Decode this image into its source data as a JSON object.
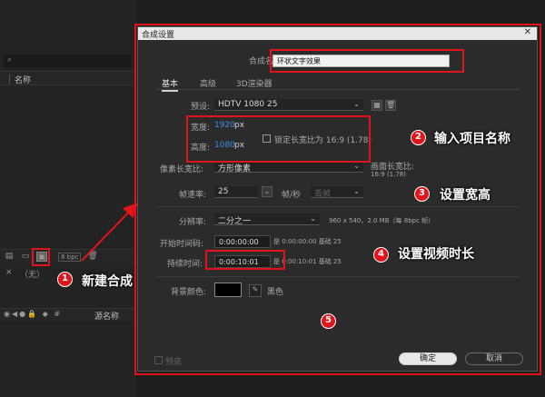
{
  "background": {
    "project_column_header": "名称",
    "bpc_label": "8 bpc",
    "comp_tab_label": "（无）",
    "layer_source_header": "源名称"
  },
  "dialog": {
    "title": "合成设置",
    "close_glyph": "✕",
    "comp_name_label": "合成名称:",
    "comp_name_value": "环状文字效果",
    "tabs": [
      "基本",
      "高级",
      "3D渲染器"
    ],
    "preset_label": "预设:",
    "preset_value": "HDTV 1080 25",
    "width_label": "宽度:",
    "width_value": "1920",
    "width_unit": "px",
    "height_label": "高度:",
    "height_value": "1080",
    "height_unit": "px",
    "lock_label": "锁定长宽比为 16:9 (1.78)",
    "pixel_aspect_label": "像素长宽比:",
    "pixel_aspect_value": "方形像素",
    "frame_aspect_label": "画面长宽比:",
    "frame_aspect_value": "16:9 (1.78)",
    "frame_rate_label": "帧速率:",
    "frame_rate_value": "25",
    "frame_rate_unit": "帧/秒",
    "frame_rate_drop": "丢帧",
    "resolution_label": "分辨率:",
    "resolution_value": "二分之一",
    "resolution_info": "960 x 540，2.0 MB（每 8bpc 帧）",
    "start_tc_label": "开始时间码:",
    "start_tc_value": "0:00:00:00",
    "start_tc_info": "是 0:00:00:00 基础 25",
    "duration_label": "持续时间:",
    "duration_value": "0:00:10:01",
    "duration_info": "是 0:00:10:01 基础 25",
    "bg_color_label": "背景颜色:",
    "bg_color_name": "黑色",
    "bg_color_hex": "#000000",
    "preview_label": "预览",
    "ok_label": "确定",
    "cancel_label": "取消"
  },
  "annotations": [
    {
      "num": "1",
      "text": "新建合成"
    },
    {
      "num": "2",
      "text": "输入项目名称"
    },
    {
      "num": "3",
      "text": "设置宽高"
    },
    {
      "num": "4",
      "text": "设置视频时长"
    },
    {
      "num": "5",
      "text": ""
    }
  ],
  "colors": {
    "annotation_red": "#e0151c",
    "accent_blue": "#3d8fe8"
  }
}
